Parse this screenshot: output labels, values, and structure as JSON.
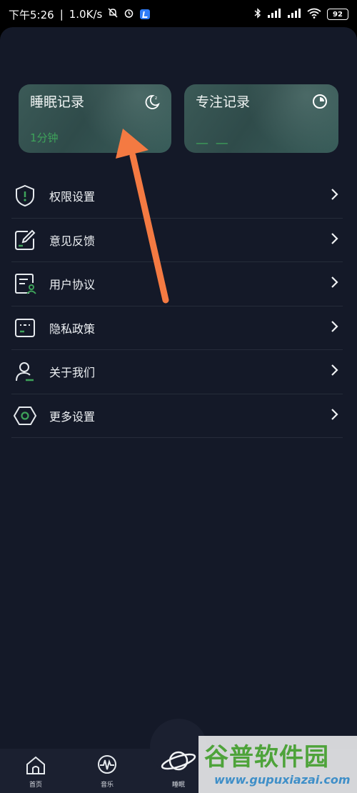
{
  "status_bar": {
    "time": "下午5:26",
    "speed": "1.0K/s",
    "battery": "92"
  },
  "cards": {
    "sleep": {
      "title": "睡眠记录",
      "value": "1分钟"
    },
    "focus": {
      "title": "专注记录",
      "value": "— —"
    }
  },
  "menu": {
    "items": [
      {
        "label": "权限设置",
        "icon": "shield-icon"
      },
      {
        "label": "意见反馈",
        "icon": "feedback-icon"
      },
      {
        "label": "用户协议",
        "icon": "user-agreement-icon"
      },
      {
        "label": "隐私政策",
        "icon": "privacy-icon"
      },
      {
        "label": "关于我们",
        "icon": "about-icon"
      },
      {
        "label": "更多设置",
        "icon": "settings-hex-icon"
      }
    ]
  },
  "tabbar": {
    "tabs": [
      {
        "label": "首页",
        "icon": "home-icon"
      },
      {
        "label": "音乐",
        "icon": "music-wave-icon"
      },
      {
        "label": "睡眠",
        "icon": "planet-icon"
      }
    ]
  },
  "watermark": {
    "title": "谷普软件园",
    "url": "www.gupuxiazai.com"
  },
  "colors": {
    "background": "#141928",
    "card": "#345150",
    "accent_green": "#3ea35a",
    "arrow": "#f47a42"
  }
}
